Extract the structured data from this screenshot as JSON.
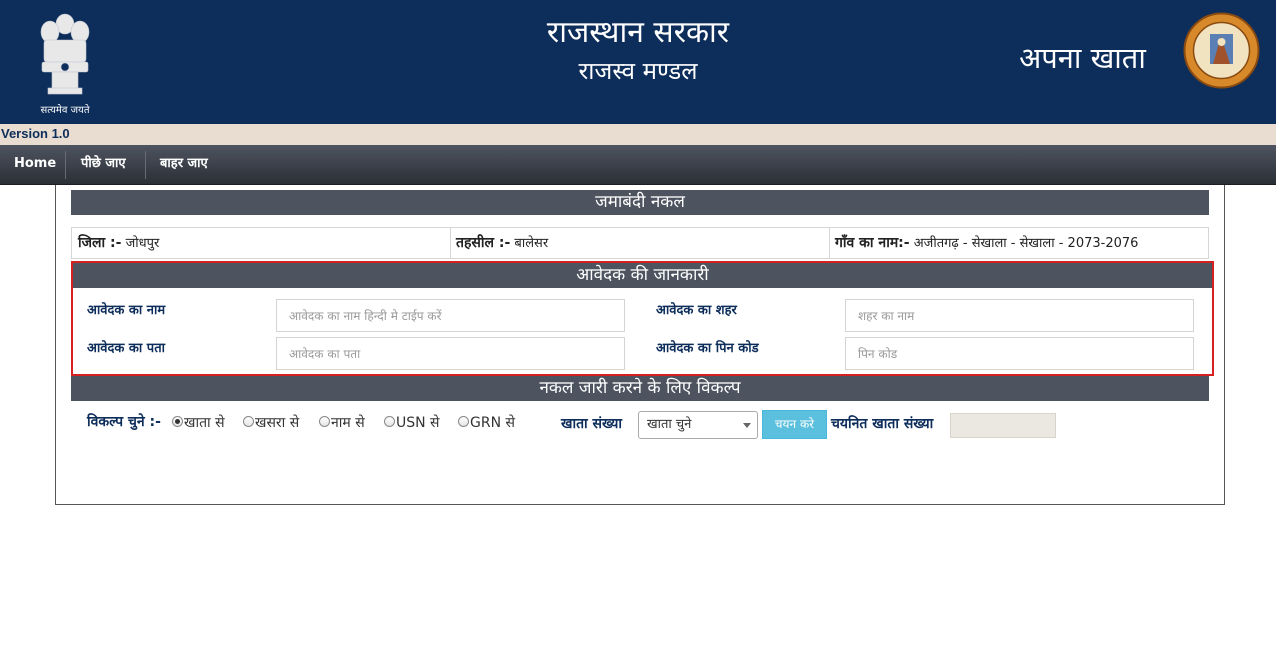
{
  "header": {
    "emblem_caption": "सत्यमेव जयते",
    "title": "राजस्थान सरकार",
    "subtitle": "राजस्व मण्डल",
    "app_name": "अपना खाता"
  },
  "version": "Version 1.0",
  "nav": {
    "items": [
      {
        "label": "Home"
      },
      {
        "label": "पीछे जाए"
      },
      {
        "label": "बाहर जाए"
      }
    ]
  },
  "jamabandi": {
    "heading": "जमाबंदी नकल",
    "district_label": "जिला :-",
    "district_value": "जोधपुर",
    "tehsil_label": "तहसील :-",
    "tehsil_value": "बालेसर",
    "village_label": "गाँव का नाम:-",
    "village_value": "अजीतगढ़ - सेखाला - सेखाला - 2073-2076"
  },
  "applicant": {
    "heading": "आवेदक की जानकारी",
    "name_label": "आवेदक का नाम",
    "name_placeholder": "आवेदक का नाम हिन्दी मे टाईप करें",
    "city_label": "आवेदक का शहर",
    "city_placeholder": "शहर का नाम",
    "address_label": "आवेदक का पता",
    "address_placeholder": "आवेदक का पता",
    "pincode_label": "आवेदक का पिन कोड",
    "pincode_placeholder": "पिन कोड"
  },
  "options": {
    "heading": "नकल जारी करने के लिए विकल्प",
    "choose_label": "विकल्प चुने :-",
    "radios": [
      {
        "label": "खाता से",
        "checked": true
      },
      {
        "label": "खसरा से",
        "checked": false
      },
      {
        "label": "नाम से",
        "checked": false
      },
      {
        "label": "USN से",
        "checked": false
      },
      {
        "label": "GRN से",
        "checked": false
      }
    ],
    "khata_label": "खाता संख्या",
    "khata_select_value": "खाता चुने",
    "select_button": "चयन करे",
    "selected_label": "चयनित खाता संख्या",
    "selected_value": ""
  },
  "colors": {
    "header_bg": "#0d2d5a",
    "section_bg": "#4d5460",
    "highlight_border": "#d42020",
    "button_bg": "#5bc0de"
  }
}
